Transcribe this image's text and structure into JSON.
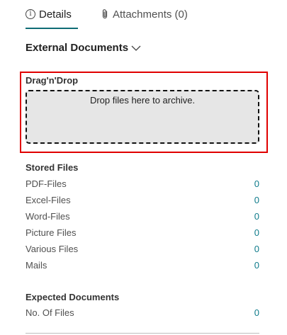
{
  "tabs": {
    "details_label": "Details",
    "attachments_label": "Attachments (0)"
  },
  "section": {
    "title": "External Documents"
  },
  "dragdrop": {
    "label": "Drag'n'Drop",
    "hint": "Drop files here to archive."
  },
  "stored_files": {
    "title": "Stored Files",
    "rows": [
      {
        "label": "PDF-Files",
        "value": "0"
      },
      {
        "label": "Excel-Files",
        "value": "0"
      },
      {
        "label": "Word-Files",
        "value": "0"
      },
      {
        "label": "Picture Files",
        "value": "0"
      },
      {
        "label": "Various Files",
        "value": "0"
      },
      {
        "label": "Mails",
        "value": "0"
      }
    ]
  },
  "expected_documents": {
    "title": "Expected Documents",
    "rows": [
      {
        "label": "No. Of Files",
        "value": "0"
      }
    ]
  },
  "colors": {
    "accent": "#0f6c75",
    "link_value": "#0f7b8b",
    "highlight_border": "#e00000",
    "dropzone_bg": "#e6e6e6"
  },
  "icons": {
    "details": "info-icon",
    "attachments": "paperclip-icon",
    "section_toggle": "chevron-down-icon"
  }
}
